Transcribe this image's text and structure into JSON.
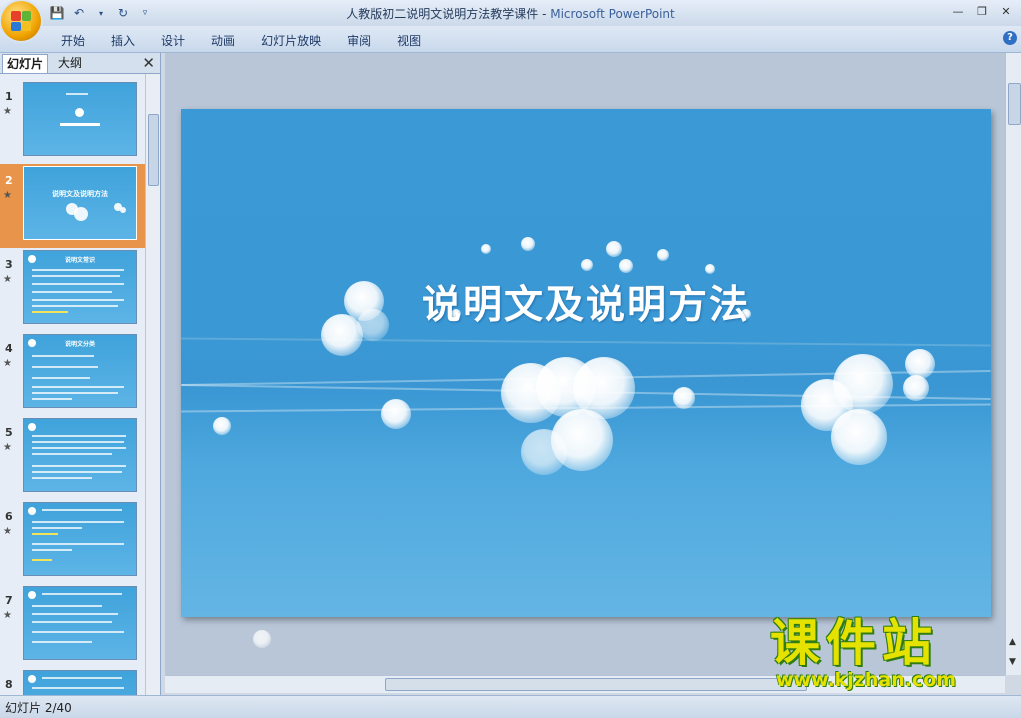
{
  "window": {
    "doc_title": "人教版初二说明文说明方法教学课件",
    "separator": " - ",
    "app_name": "Microsoft PowerPoint"
  },
  "quick_access": [
    "save-icon",
    "undo-icon",
    "dropdown-icon",
    "redo-icon",
    "customize-icon"
  ],
  "ribbon": {
    "tabs": [
      "开始",
      "插入",
      "设计",
      "动画",
      "幻灯片放映",
      "审阅",
      "视图"
    ],
    "help": "?"
  },
  "left_pane": {
    "tab_slides": "幻灯片",
    "tab_outline": "大纲",
    "close": "✕",
    "thumbnails": [
      {
        "num": "1",
        "title": "",
        "selected": false
      },
      {
        "num": "2",
        "title": "说明文及说明方法",
        "selected": true
      },
      {
        "num": "3",
        "title": "说明文常识",
        "selected": false
      },
      {
        "num": "4",
        "title": "说明文分类",
        "selected": false
      },
      {
        "num": "5",
        "title": "",
        "selected": false
      },
      {
        "num": "6",
        "title": "",
        "selected": false
      },
      {
        "num": "7",
        "title": "",
        "selected": false
      },
      {
        "num": "8",
        "title": "",
        "selected": false
      }
    ]
  },
  "slide": {
    "title": "说明文及说明方法",
    "background_color": "#3b9ad6"
  },
  "status": {
    "text": "幻灯片 2/40"
  },
  "watermark": {
    "logo_text": "课件站",
    "url": "www.kjzhan.com"
  }
}
